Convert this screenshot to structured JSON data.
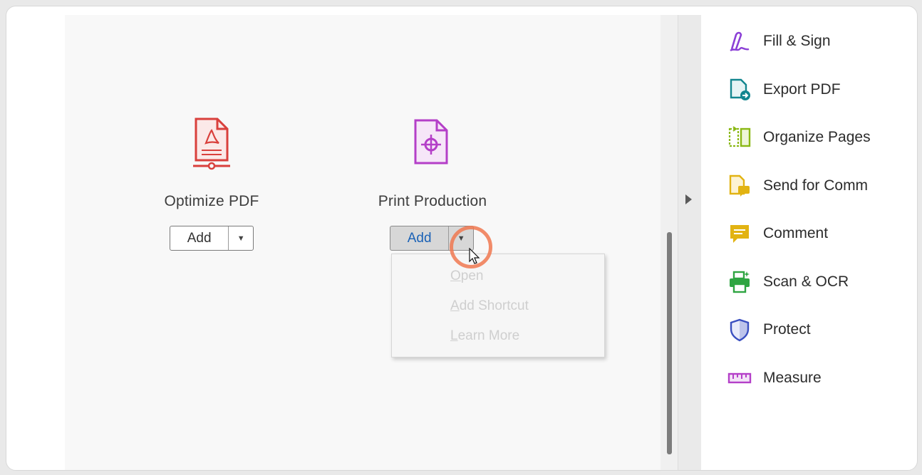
{
  "tools": [
    {
      "name": "Optimize PDF",
      "button_label": "Add",
      "icon": "optimize-pdf-icon",
      "color": "#d9403c"
    },
    {
      "name": "Print Production",
      "button_label": "Add",
      "icon": "print-production-icon",
      "color": "#b43fc8"
    }
  ],
  "dropdown": {
    "items": [
      {
        "label_first": "O",
        "label_rest": "pen"
      },
      {
        "label_first": "A",
        "label_rest": "dd Shortcut"
      },
      {
        "label_first": "L",
        "label_rest": "earn More"
      }
    ]
  },
  "right_panel": {
    "items": [
      {
        "label": "Fill & Sign",
        "icon": "fill-sign-icon",
        "color": "#8b3fd6"
      },
      {
        "label": "Export PDF",
        "icon": "export-pdf-icon",
        "color": "#13868f"
      },
      {
        "label": "Organize Pages",
        "icon": "organize-pages-icon",
        "color": "#8ab814"
      },
      {
        "label": "Send for Comm",
        "icon": "send-for-comment-icon",
        "color": "#e2b312"
      },
      {
        "label": "Comment",
        "icon": "comment-icon",
        "color": "#e2b312"
      },
      {
        "label": "Scan & OCR",
        "icon": "scan-ocr-icon",
        "color": "#2fa542"
      },
      {
        "label": "Protect",
        "icon": "protect-icon",
        "color": "#3a4fc0"
      },
      {
        "label": "Measure",
        "icon": "measure-icon",
        "color": "#b43fc8"
      }
    ]
  }
}
